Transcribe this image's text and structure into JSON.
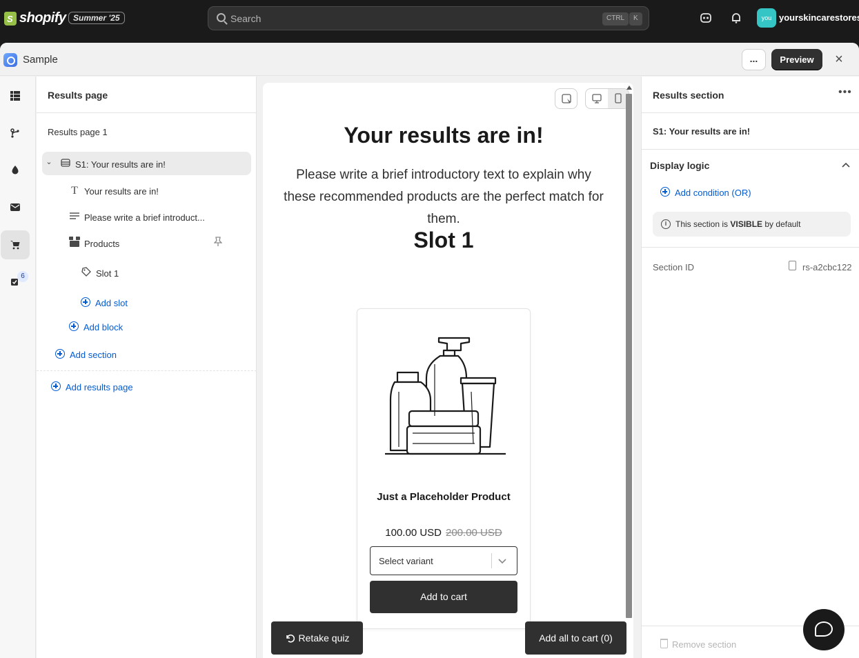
{
  "topbar": {
    "logo_text": "shopify",
    "edition_badge": "Summer '25",
    "search_placeholder": "Search",
    "shortcut_ctrl": "CTRL",
    "shortcut_k": "K",
    "avatar_text": "you",
    "store_name": "yourskincarestores"
  },
  "window": {
    "app_title": "Sample",
    "more_label": "...",
    "preview_label": "Preview",
    "close_icon": "×"
  },
  "rail": {
    "badge_count": "6",
    "icons": [
      "grid-icon",
      "branch-icon",
      "drop-icon",
      "mail-icon",
      "cart-icon",
      "checklist-icon"
    ]
  },
  "tree": {
    "header": "Results page",
    "page_label": "Results page 1",
    "section_label": "S1: Your results are in!",
    "block_heading": "Your results are in!",
    "block_text": "Please write a brief introduct...",
    "block_products": "Products",
    "slot_label": "Slot 1",
    "add_slot": "Add slot",
    "add_block": "Add block",
    "add_section": "Add section",
    "add_results_page": "Add results page"
  },
  "canvas": {
    "title": "Your results are in!",
    "intro": "Please write a brief introductory text to explain why these recommended products are the perfect match for them.",
    "slot_title": "Slot 1",
    "product_name": "Just a Placeholder Product",
    "price": "100.00 USD",
    "compare_price": "200.00 USD",
    "variant_placeholder": "Select variant",
    "add_to_cart": "Add to cart",
    "retake_quiz": "Retake quiz",
    "add_all_to_cart": "Add all to cart (0)"
  },
  "props": {
    "header": "Results section",
    "section_name": "S1: Your results are in!",
    "display_logic_title": "Display logic",
    "add_condition": "Add condition (OR)",
    "visibility_prefix": "This section is ",
    "visibility_state": "VISIBLE",
    "visibility_suffix": " by default",
    "section_id_label": "Section ID",
    "section_id_value": "rs-a2cbc122",
    "remove_section": "Remove section"
  },
  "colors": {
    "topbar_bg": "#1a1a1a",
    "primary_button": "#303030",
    "link": "#005bd3",
    "avatar": "#36c5c5"
  }
}
